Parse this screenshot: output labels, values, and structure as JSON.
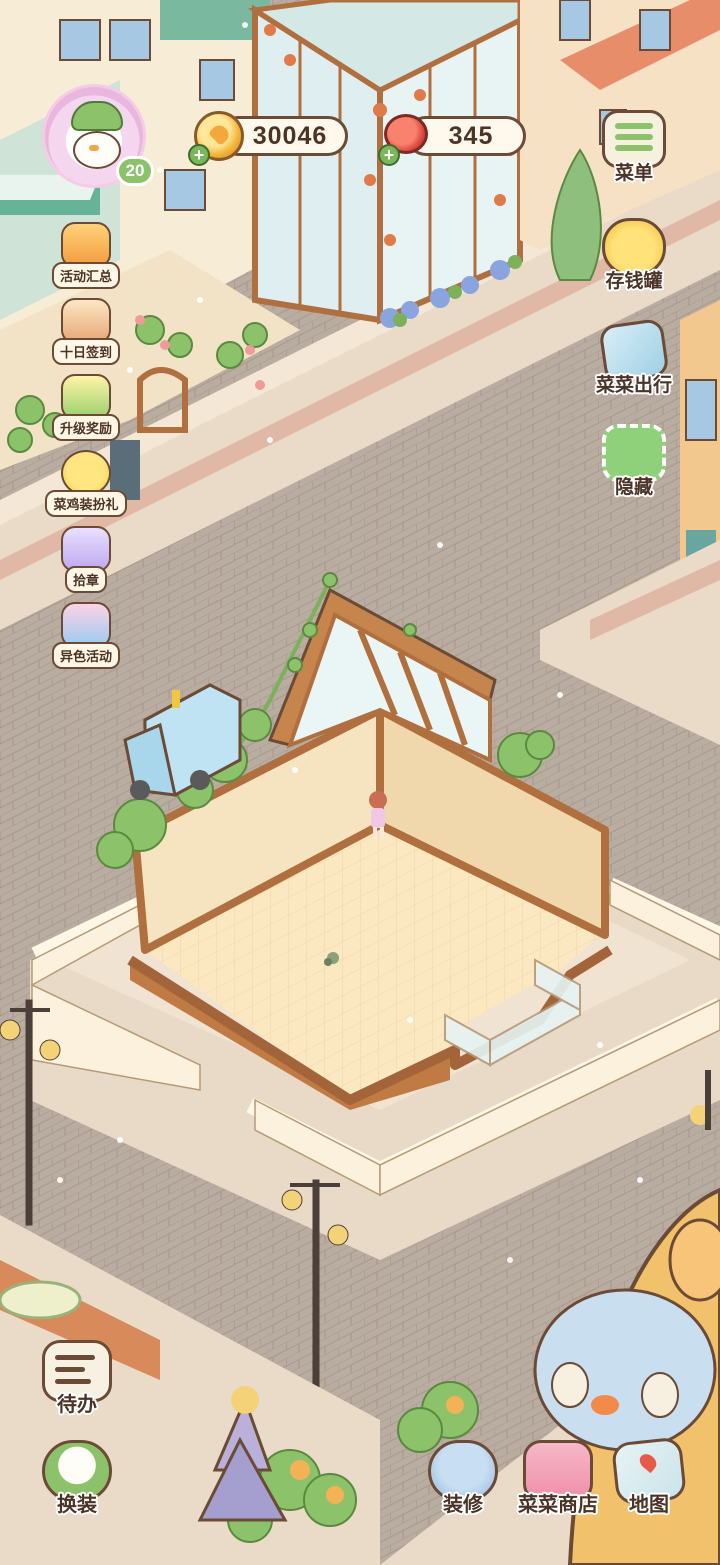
{
  "currency": {
    "coins": "30046",
    "meat": "345"
  },
  "player": {
    "level": "20",
    "avatar_icon": "chicken-avatar-icon"
  },
  "left_menu": [
    {
      "label": "活动汇总",
      "icon": "event-summary-icon"
    },
    {
      "label": "十日签到",
      "icon": "ten-day-checkin-icon"
    },
    {
      "label": "升级奖励",
      "icon": "level-reward-icon"
    },
    {
      "label": "菜鸡装扮礼",
      "icon": "chick-costume-gift-icon"
    },
    {
      "label": "拾章",
      "icon": "stamp-collect-icon"
    },
    {
      "label": "异色活动",
      "icon": "color-event-icon"
    }
  ],
  "right_menu": [
    {
      "label": "菜单",
      "icon": "menu-icon"
    },
    {
      "label": "存钱罐",
      "icon": "piggy-bank-icon"
    },
    {
      "label": "菜菜出行",
      "icon": "travel-icon"
    },
    {
      "label": "隐藏",
      "icon": "hide-icon"
    }
  ],
  "bottom_menu": {
    "todo": "待办",
    "dressup": "换装",
    "decorate": "装修",
    "shop": "菜菜商店",
    "map": "地图"
  },
  "colors": {
    "road": "#b9aca0",
    "sidewalk": "#eadbc8",
    "floor": "#f9e2b7",
    "wall": "#f3ddb8",
    "wood": "#b06f3e",
    "outline": "#6b4a36",
    "green": "#8cc36a"
  }
}
